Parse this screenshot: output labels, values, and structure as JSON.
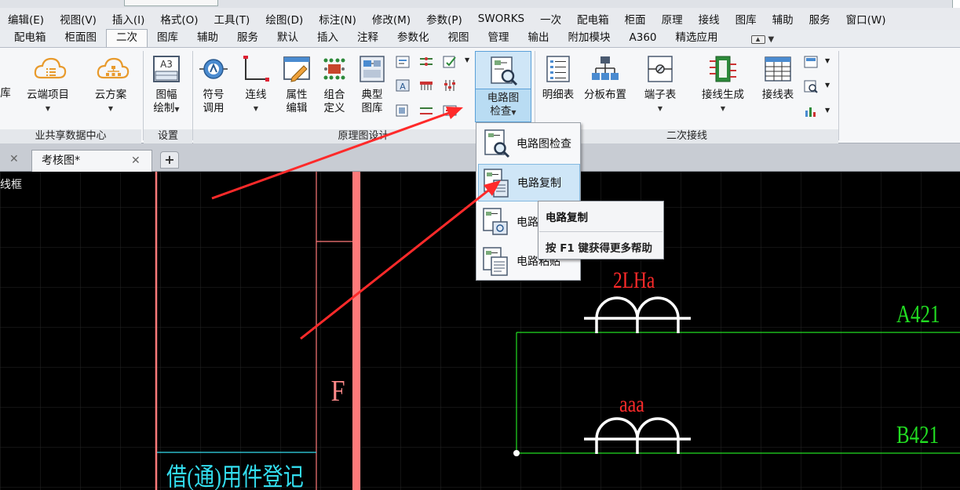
{
  "menu": {
    "items": [
      "编辑(E)",
      "视图(V)",
      "插入(I)",
      "格式(O)",
      "工具(T)",
      "绘图(D)",
      "标注(N)",
      "修改(M)",
      "参数(P)",
      "SWORKS",
      "一次",
      "配电箱",
      "柜面",
      "原理",
      "接线",
      "图库",
      "辅助",
      "服务",
      "窗口(W)"
    ]
  },
  "ribbon_tabs": {
    "items": [
      "配电箱",
      "柜面图",
      "二次",
      "图库",
      "辅助",
      "服务",
      "默认",
      "插入",
      "注释",
      "参数化",
      "视图",
      "管理",
      "输出",
      "附加模块",
      "A360",
      "精选应用"
    ],
    "active_index": 2
  },
  "ribbon": {
    "cloud": {
      "partial_label": "库",
      "project_label": "云端项目",
      "scheme_label": "云方案",
      "group_label": "业共享数据中心"
    },
    "settings": {
      "frame_icon_text": "A3",
      "frame_label_1": "图幅",
      "frame_label_2": "绘制",
      "group_label": "设置"
    },
    "schematic": {
      "symbol_label_1": "符号",
      "symbol_label_2": "调用",
      "wire_label": "连线",
      "attr_label_1": "属性",
      "attr_label_2": "编辑",
      "combo_label_1": "组合",
      "combo_label_2": "定义",
      "typical_label_1": "典型",
      "typical_label_2": "图库",
      "check_label_1": "电路图",
      "check_label_2": "检查",
      "group_label": "原理图设计"
    },
    "secondary": {
      "list_label": "明细表",
      "board_label": "分板布置",
      "terminal_label": "端子表",
      "gen_label": "接线生成",
      "wiretable_label": "接线表",
      "group_label": "二次接线"
    }
  },
  "doc_tabs": {
    "active": "考核图*"
  },
  "canvas": {
    "left_text": "线框",
    "cell_text": "借(通)用件登记",
    "f_label": "F",
    "lh_label": "2LHa",
    "aaa_label": "aaa",
    "a421": "A421",
    "b421": "B421"
  },
  "dropdown": {
    "items": [
      "电路图检查",
      "电路复制",
      "电路",
      "电路粘贴"
    ]
  },
  "tooltip": {
    "title": "电路复制",
    "help": "按 F1 键获得更多帮助"
  },
  "colors": {
    "arrow": "#ff2a2a",
    "cad_red": "#ff6a6a",
    "cad_green": "#22dd22",
    "cad_cyan": "#33ddee",
    "highlight": "#cfe6f7"
  }
}
